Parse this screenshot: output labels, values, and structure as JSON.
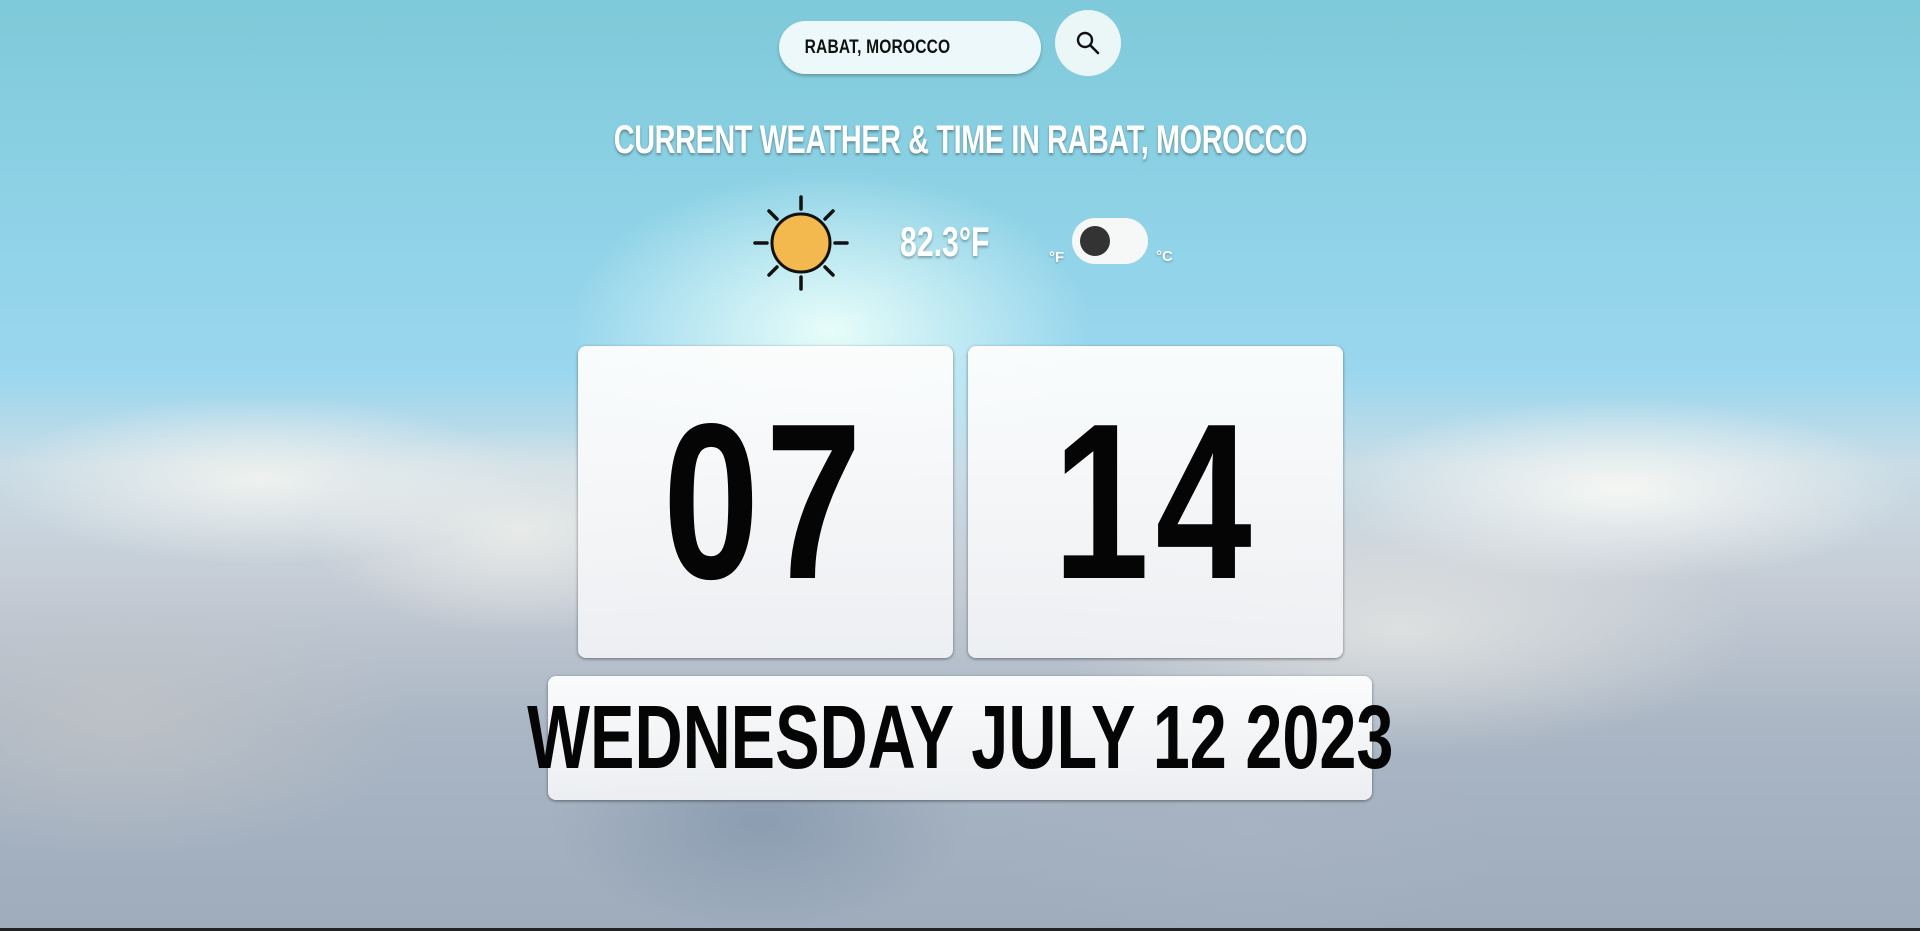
{
  "search": {
    "value": "RABAT, MOROCCO",
    "button_icon": "search-icon"
  },
  "header": {
    "title": "CURRENT WEATHER & TIME IN RABAT, MOROCCO"
  },
  "weather": {
    "icon": "sun-icon",
    "temperature": "82.3°F",
    "unit_toggle": {
      "left_label": "°F",
      "right_label": "°C",
      "selected": "°F"
    }
  },
  "clock": {
    "hours": "07",
    "minutes": "14"
  },
  "date": {
    "text": "WEDNESDAY JULY 12 2023"
  },
  "colors": {
    "sun_fill": "#f4b94e",
    "toggle_knob": "#333333",
    "text_dark": "#050505"
  }
}
